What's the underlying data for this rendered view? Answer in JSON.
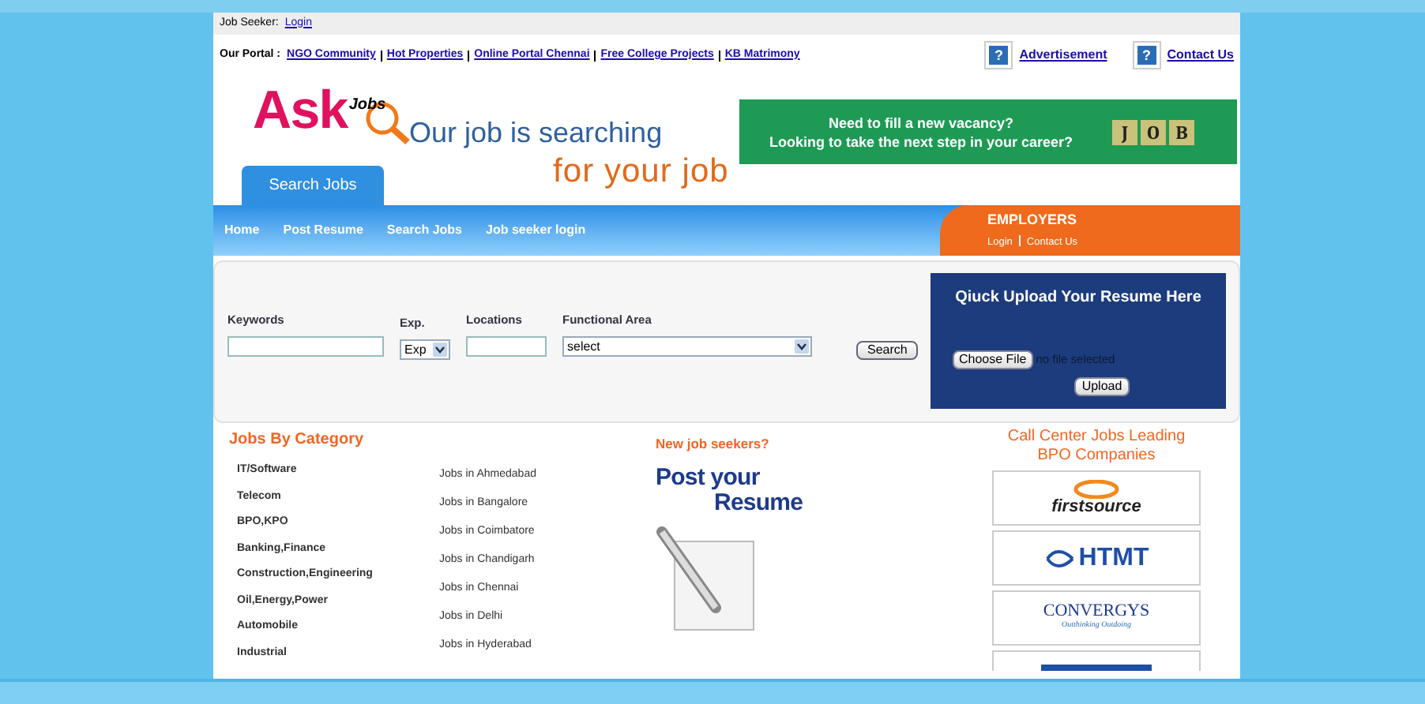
{
  "top_bar": {
    "label": "Job Seeker:",
    "link": "Login"
  },
  "portal": {
    "label": "Our Portal :",
    "links": [
      "NGO Community",
      "Hot Properties",
      "Online Portal Chennai",
      "Free College Projects",
      "KB Matrimony"
    ],
    "right_links": [
      {
        "icon": "?",
        "label": "Advertisement"
      },
      {
        "icon": "?",
        "label": "Contact Us"
      }
    ]
  },
  "logo": {
    "main": "Ask",
    "sub": "Jobs"
  },
  "tagline": [
    "Our job is searching",
    "for your job"
  ],
  "banner": {
    "lines": [
      "Need to fill a new vacancy?",
      "Looking to take the next step in your career?"
    ],
    "tiles": [
      "J",
      "O",
      "B"
    ]
  },
  "header_tab": {
    "label": "Search Jobs",
    "selected": true
  },
  "nav": [
    "Home",
    "Post Resume",
    "Search Jobs",
    "Job seeker login"
  ],
  "employers": {
    "title": "EMPLOYERS",
    "links": [
      "Login",
      "Contact Us"
    ]
  },
  "search": {
    "fields": [
      {
        "kind": "text",
        "label": "Keywords"
      },
      {
        "kind": "select",
        "label": "Exp.",
        "value": "Exp"
      },
      {
        "kind": "text",
        "label": "Locations"
      },
      {
        "kind": "select",
        "label": "Functional Area",
        "value": "select"
      }
    ],
    "button": "Search"
  },
  "upload": {
    "title": "Qiuck Upload Your Resume Here",
    "choose": "Choose File",
    "status": "no file selected",
    "button": "Upload"
  },
  "categories": {
    "title": "Jobs By Category",
    "items": [
      "IT/Software",
      "Telecom",
      "BPO,KPO",
      "Banking,Finance",
      "Construction,Engineering",
      "Oil,Energy,Power",
      "Automobile",
      "Industrial"
    ],
    "cities": [
      "Jobs in Ahmedabad",
      "Jobs in Bangalore",
      "Jobs in Coimbatore",
      "Jobs in Chandigarh",
      "Jobs in Chennai",
      "Jobs in Delhi",
      "Jobs in Hyderabad"
    ]
  },
  "new_seekers": {
    "title": "New job seekers?",
    "promo": [
      "Post your",
      "Resume"
    ]
  },
  "bpo": {
    "title": "Call Center Jobs Leading BPO Companies",
    "companies": [
      {
        "kind": "firstsource",
        "name": "firstsource"
      },
      {
        "kind": "htmt",
        "name": "HTMT"
      },
      {
        "kind": "convergys",
        "name": "CONVERGYS",
        "tagline": "Outthinking Outdoing"
      },
      {
        "kind": "cut"
      }
    ]
  }
}
